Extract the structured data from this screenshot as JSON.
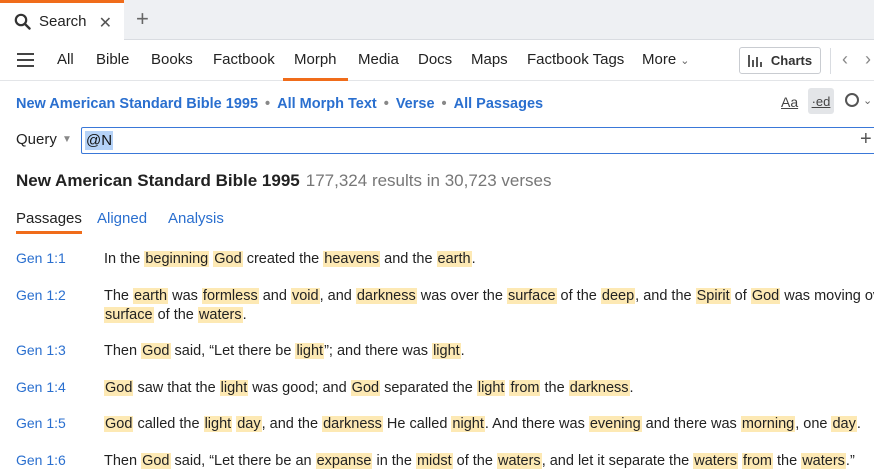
{
  "tabs": {
    "search_tab_label": "Search",
    "close_glyph": "✕",
    "new_tab_glyph": "+"
  },
  "nav": {
    "items": [
      "All",
      "Bible",
      "Books",
      "Factbook",
      "Morph",
      "Media",
      "Docs",
      "Maps",
      "Factbook Tags",
      "More"
    ],
    "active": "Morph",
    "charts_label": "Charts"
  },
  "breadcrumb": {
    "bible": "New American Standard Bible 1995",
    "text": "All Morph Text",
    "unit": "Verse",
    "range": "All Passages"
  },
  "tools": {
    "aa_label": "Aa",
    "ed_label": "·ed"
  },
  "query": {
    "label": "Query",
    "value": "@N"
  },
  "results": {
    "title": "New American Standard Bible 1995",
    "count": "177,324 results in 30,723 verses"
  },
  "subtabs": [
    "Passages",
    "Aligned",
    "Analysis"
  ],
  "rows": [
    {
      "ref": "Gen 1:1",
      "segments": [
        [
          "In the ",
          0
        ],
        [
          "beginning",
          1
        ],
        [
          " ",
          0
        ],
        [
          "God",
          1
        ],
        [
          " created the ",
          0
        ],
        [
          "heavens",
          1
        ],
        [
          " and the ",
          0
        ],
        [
          "earth",
          1
        ],
        [
          ".",
          0
        ]
      ]
    },
    {
      "ref": "Gen 1:2",
      "segments": [
        [
          "The ",
          0
        ],
        [
          "earth",
          1
        ],
        [
          " was ",
          0
        ],
        [
          "formless",
          1
        ],
        [
          " and ",
          0
        ],
        [
          "void",
          1
        ],
        [
          ", and ",
          0
        ],
        [
          "darkness",
          1
        ],
        [
          " was over the ",
          0
        ],
        [
          "surface",
          1
        ],
        [
          " of the ",
          0
        ],
        [
          "deep",
          1
        ],
        [
          ", and the ",
          0
        ],
        [
          "Spirit",
          1
        ],
        [
          " of ",
          0
        ],
        [
          "God",
          1
        ],
        [
          " was moving over the",
          0
        ]
      ],
      "segments2": [
        [
          "surface",
          1
        ],
        [
          " of the ",
          0
        ],
        [
          "waters",
          1
        ],
        [
          ".",
          0
        ]
      ]
    },
    {
      "ref": "Gen 1:3",
      "segments": [
        [
          "Then ",
          0
        ],
        [
          "God",
          1
        ],
        [
          " said, “Let there be ",
          0
        ],
        [
          "light",
          1
        ],
        [
          "”; and there was ",
          0
        ],
        [
          "light",
          1
        ],
        [
          ".",
          0
        ]
      ]
    },
    {
      "ref": "Gen 1:4",
      "segments": [
        [
          "God",
          1
        ],
        [
          " saw that the ",
          0
        ],
        [
          "light",
          1
        ],
        [
          " was good; and ",
          0
        ],
        [
          "God",
          1
        ],
        [
          " separated the ",
          0
        ],
        [
          "light",
          1
        ],
        [
          " ",
          0
        ],
        [
          "from",
          1
        ],
        [
          " the ",
          0
        ],
        [
          "darkness",
          1
        ],
        [
          ".",
          0
        ]
      ]
    },
    {
      "ref": "Gen 1:5",
      "segments": [
        [
          "God",
          1
        ],
        [
          " called the ",
          0
        ],
        [
          "light",
          1
        ],
        [
          " ",
          0
        ],
        [
          "day",
          1
        ],
        [
          ", and the ",
          0
        ],
        [
          "darkness",
          1
        ],
        [
          " He called ",
          0
        ],
        [
          "night",
          1
        ],
        [
          ". And there was ",
          0
        ],
        [
          "evening",
          1
        ],
        [
          " and there was ",
          0
        ],
        [
          "morning",
          1
        ],
        [
          ", one ",
          0
        ],
        [
          "day",
          1
        ],
        [
          ".",
          0
        ]
      ]
    },
    {
      "ref": "Gen 1:6",
      "segments": [
        [
          "Then ",
          0
        ],
        [
          "God",
          1
        ],
        [
          " said, “Let there be an ",
          0
        ],
        [
          "expanse",
          1
        ],
        [
          " in the ",
          0
        ],
        [
          "midst",
          1
        ],
        [
          " of the ",
          0
        ],
        [
          "waters",
          1
        ],
        [
          ", and let it separate the ",
          0
        ],
        [
          "waters",
          1
        ],
        [
          " ",
          0
        ],
        [
          "from",
          1
        ],
        [
          " the ",
          0
        ],
        [
          "waters",
          1
        ],
        [
          ".”",
          0
        ]
      ]
    }
  ],
  "colors": {
    "accent": "#f06c1a",
    "link": "#2a6fcf",
    "highlight": "#fde9b4"
  }
}
